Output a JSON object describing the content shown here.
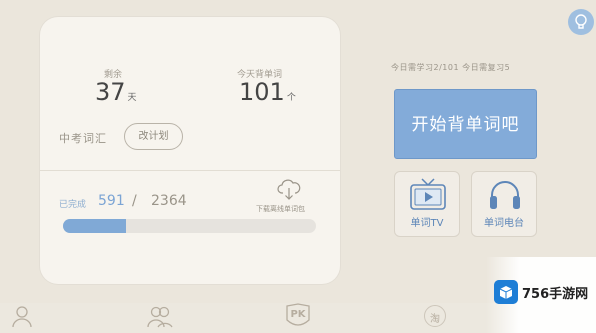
{
  "stats": {
    "remaining_label": "剩余",
    "remaining_value": "37",
    "remaining_unit": "天",
    "today_label": "今天背单词",
    "today_value": "101",
    "today_unit": "个"
  },
  "vocab": {
    "title": "中考词汇",
    "plan_button": "改计划"
  },
  "progress": {
    "done_label": "已完成",
    "done": "591",
    "slash": "/",
    "total": "2364",
    "fraction": 0.25,
    "download_label": "下载离线单词包"
  },
  "today_summary": "今日需学习2/101  今日需复习5",
  "start_button": "开始背单词吧",
  "tiles": {
    "tv_label": "单词TV",
    "radio_label": "单词电台"
  },
  "nav": {
    "pk_label": "PK",
    "shop_label": "淘"
  },
  "watermark": {
    "text": "756手游网"
  },
  "colors": {
    "accent": "#83abd9",
    "background": "#ebe6dc"
  },
  "icons": [
    "lightbulb-icon",
    "cloud-download-icon",
    "tv-icon",
    "headphones-icon",
    "user-icon",
    "friends-icon",
    "pk-icon",
    "shop-icon"
  ]
}
